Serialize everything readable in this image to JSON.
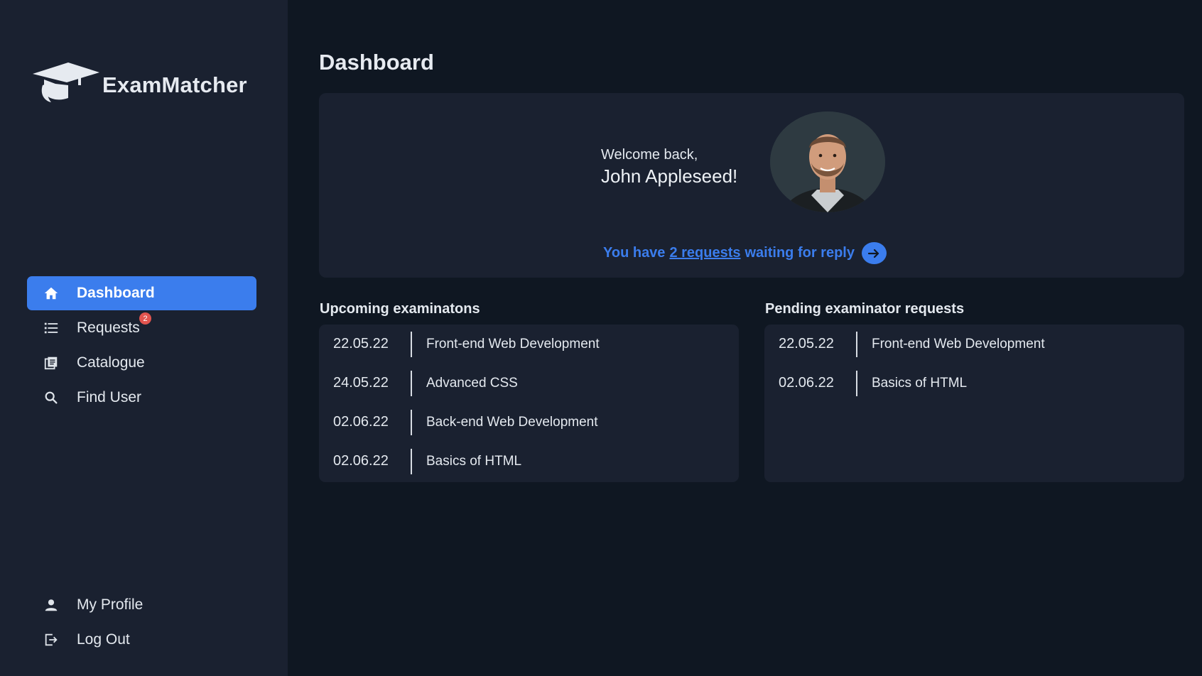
{
  "app": {
    "name": "ExamMatcher"
  },
  "sidebar": {
    "items": [
      {
        "label": "Dashboard",
        "icon": "home-icon",
        "active": true
      },
      {
        "label": "Requests",
        "icon": "list-icon",
        "badge": "2"
      },
      {
        "label": "Catalogue",
        "icon": "catalogue-icon"
      },
      {
        "label": "Find User",
        "icon": "search-icon"
      }
    ],
    "bottom": [
      {
        "label": "My Profile",
        "icon": "user-icon"
      },
      {
        "label": "Log Out",
        "icon": "logout-icon"
      }
    ]
  },
  "main": {
    "title": "Dashboard",
    "welcome": {
      "greeting": "Welcome back,",
      "name": "John Appleseed!",
      "requests_prefix": "You have",
      "requests_link": "2 requests",
      "requests_suffix": "waiting for reply"
    },
    "upcoming": {
      "title": "Upcoming examinatons",
      "rows": [
        {
          "date": "22.05.22",
          "name": "Front-end Web Development"
        },
        {
          "date": "24.05.22",
          "name": "Advanced CSS"
        },
        {
          "date": "02.06.22",
          "name": "Back-end Web Development"
        },
        {
          "date": "02.06.22",
          "name": "Basics of HTML"
        }
      ]
    },
    "pending": {
      "title": "Pending examinator requests",
      "rows": [
        {
          "date": "22.05.22",
          "name": "Front-end Web Development"
        },
        {
          "date": "02.06.22",
          "name": "Basics of HTML"
        }
      ]
    }
  },
  "colors": {
    "background": "#0f1722",
    "panel": "#1a2130",
    "accent": "#3b7ded",
    "badge": "#e2544f"
  }
}
